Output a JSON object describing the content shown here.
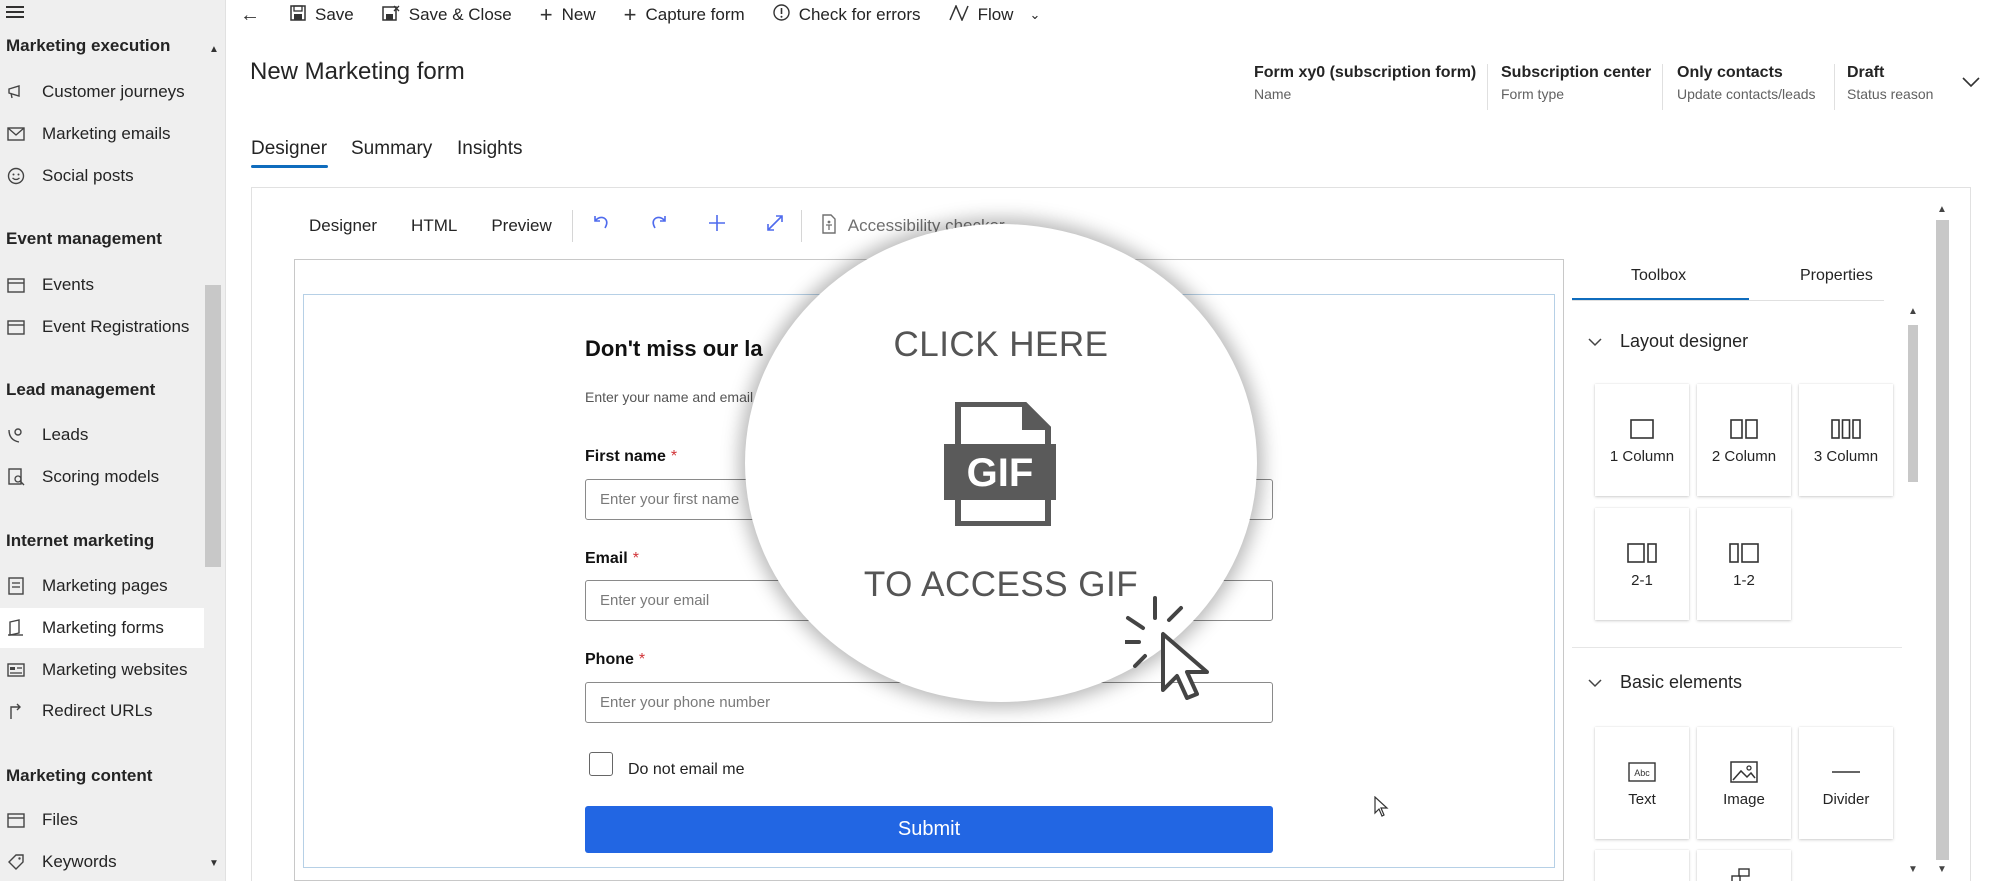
{
  "sidebar": {
    "groups": [
      {
        "header": "Marketing execution",
        "items": [
          {
            "label": "Customer journeys",
            "icon": "journey-icon"
          },
          {
            "label": "Marketing emails",
            "icon": "mail-icon"
          },
          {
            "label": "Social posts",
            "icon": "social-icon"
          }
        ]
      },
      {
        "header": "Event management",
        "items": [
          {
            "label": "Events",
            "icon": "calendar-icon"
          },
          {
            "label": "Event Registrations",
            "icon": "calendar-icon"
          }
        ]
      },
      {
        "header": "Lead management",
        "items": [
          {
            "label": "Leads",
            "icon": "phone-person-icon"
          },
          {
            "label": "Scoring models",
            "icon": "scoring-icon"
          }
        ]
      },
      {
        "header": "Internet marketing",
        "items": [
          {
            "label": "Marketing pages",
            "icon": "page-icon"
          },
          {
            "label": "Marketing forms",
            "icon": "form-icon",
            "selected": true
          },
          {
            "label": "Marketing websites",
            "icon": "website-icon"
          },
          {
            "label": "Redirect URLs",
            "icon": "redirect-icon"
          }
        ]
      },
      {
        "header": "Marketing content",
        "items": [
          {
            "label": "Files",
            "icon": "file-icon"
          },
          {
            "label": "Keywords",
            "icon": "keyword-icon"
          }
        ]
      }
    ]
  },
  "toolbar": {
    "save": "Save",
    "save_close": "Save & Close",
    "new": "New",
    "capture_form": "Capture form",
    "check_errors": "Check for errors",
    "flow": "Flow"
  },
  "header": {
    "title": "New Marketing form",
    "fields": [
      {
        "value": "Form xy0 (subscription form)",
        "label": "Name"
      },
      {
        "value": "Subscription center",
        "label": "Form type"
      },
      {
        "value": "Only contacts",
        "label": "Update contacts/leads"
      },
      {
        "value": "Draft",
        "label": "Status reason"
      }
    ]
  },
  "tabs": [
    "Designer",
    "Summary",
    "Insights"
  ],
  "designer": {
    "subtabs": [
      "Designer",
      "HTML",
      "Preview"
    ],
    "accessibility": "Accessibility checker"
  },
  "form": {
    "title": "Don't miss our la",
    "subtitle": "Enter your name and email",
    "fields": [
      {
        "label": "First name",
        "required": "*",
        "placeholder": "Enter your first name"
      },
      {
        "label": "Email",
        "required": "*",
        "placeholder": "Enter your email"
      },
      {
        "label": "Phone",
        "required": "*",
        "placeholder": "Enter your phone number"
      }
    ],
    "checkbox_label": "Do not email me",
    "submit": "Submit"
  },
  "toolbox": {
    "tabs": [
      "Toolbox",
      "Properties"
    ],
    "layout_header": "Layout designer",
    "layout_tiles": [
      "1 Column",
      "2 Column",
      "3 Column",
      "2-1",
      "1-2"
    ],
    "basic_header": "Basic elements",
    "basic_tiles": [
      "Text",
      "Image",
      "Divider"
    ]
  },
  "overlay": {
    "top_text": "CLICK HERE",
    "icon_text": "GIF",
    "bottom_text": "TO ACCESS GIF"
  }
}
